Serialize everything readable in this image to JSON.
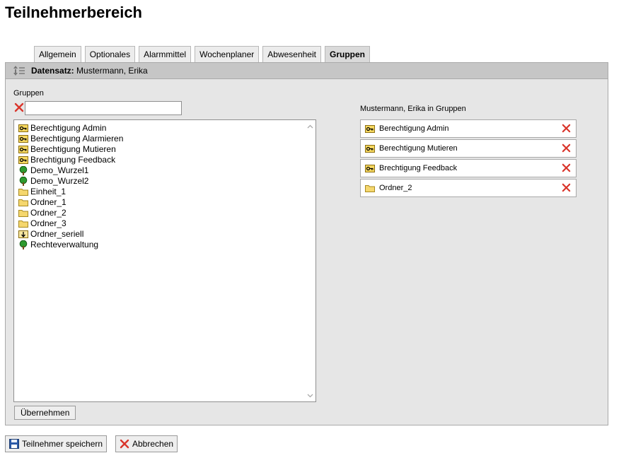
{
  "page": {
    "title": "Teilnehmerbereich"
  },
  "tabs": [
    {
      "label": "Allgemein",
      "active": false
    },
    {
      "label": "Optionales",
      "active": false
    },
    {
      "label": "Alarmmittel",
      "active": false
    },
    {
      "label": "Wochenplaner",
      "active": false
    },
    {
      "label": "Abwesenheit",
      "active": false
    },
    {
      "label": "Gruppen",
      "active": true
    }
  ],
  "record": {
    "label": "Datensatz:",
    "value": "Mustermann, Erika"
  },
  "groups": {
    "label": "Gruppen",
    "filter_value": "",
    "items": [
      {
        "label": "Berechtigung Admin",
        "icon": "key-icon"
      },
      {
        "label": "Berechtigung Alarmieren",
        "icon": "key-icon"
      },
      {
        "label": "Berechtigung Mutieren",
        "icon": "key-icon"
      },
      {
        "label": "Brechtigung Feedback",
        "icon": "key-icon"
      },
      {
        "label": "Demo_Wurzel1",
        "icon": "tree-icon"
      },
      {
        "label": "Demo_Wurzel2",
        "icon": "tree-icon"
      },
      {
        "label": "Einheit_1",
        "icon": "folder-icon"
      },
      {
        "label": "Ordner_1",
        "icon": "folder-icon"
      },
      {
        "label": "Ordner_2",
        "icon": "folder-icon"
      },
      {
        "label": "Ordner_3",
        "icon": "folder-icon"
      },
      {
        "label": "Ordner_seriell",
        "icon": "serial-icon"
      },
      {
        "label": "Rechteverwaltung",
        "icon": "tree-icon"
      }
    ],
    "apply_label": "Übernehmen"
  },
  "assigned": {
    "label": "Mustermann, Erika in Gruppen",
    "items": [
      {
        "label": "Berechtigung Admin",
        "icon": "key-icon"
      },
      {
        "label": "Berechtigung Mutieren",
        "icon": "key-icon"
      },
      {
        "label": "Brechtigung Feedback",
        "icon": "key-icon"
      },
      {
        "label": "Ordner_2",
        "icon": "folder-icon"
      }
    ]
  },
  "footer": {
    "save_label": "Teilnehmer speichern",
    "cancel_label": "Abbrechen"
  },
  "colors": {
    "delete": "#d9352b",
    "folder": "#f5d76e",
    "tree": "#2e9a2e"
  }
}
